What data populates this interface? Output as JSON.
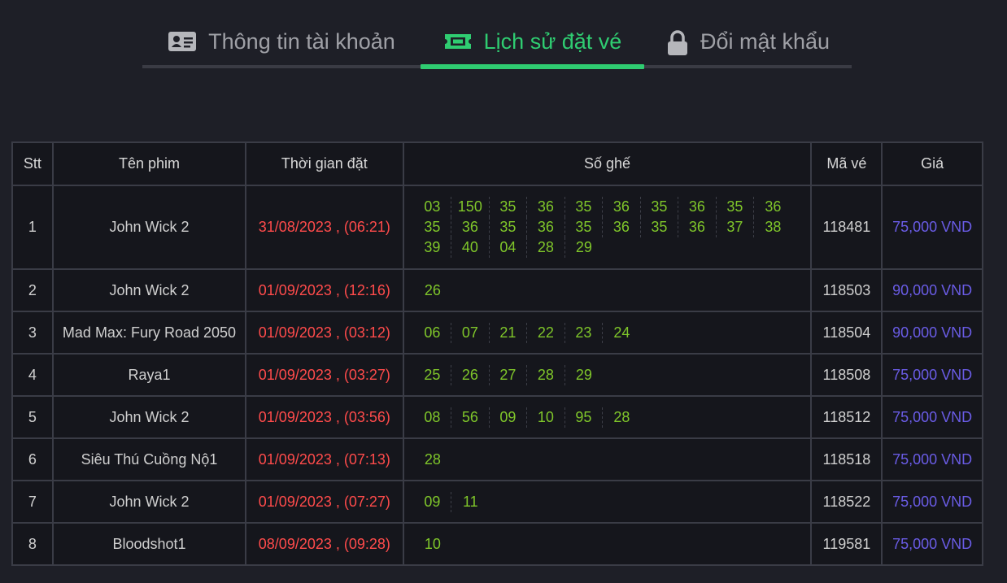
{
  "tabs": [
    {
      "label": "Thông tin tài khoản",
      "icon": "id-card-icon"
    },
    {
      "label": "Lịch sử đặt vé",
      "icon": "ticket-icon",
      "active": true
    },
    {
      "label": "Đổi mật khẩu",
      "icon": "lock-icon"
    }
  ],
  "colors": {
    "active_tab": "#2fcc71",
    "time": "#ff4b4b",
    "seat": "#7fc62a",
    "price": "#6a5ce6"
  },
  "table": {
    "headers": [
      "Stt",
      "Tên phim",
      "Thời gian đặt",
      "Số ghế",
      "Mã vé",
      "Giá"
    ],
    "rows": [
      {
        "stt": "1",
        "film": "John Wick 2",
        "time": "31/08/2023 , (06:21)",
        "seats": [
          "03",
          "150",
          "35",
          "36",
          "35",
          "36",
          "35",
          "36",
          "35",
          "36",
          "35",
          "36",
          "35",
          "36",
          "35",
          "36",
          "35",
          "36",
          "37",
          "38",
          "39",
          "40",
          "04",
          "28",
          "29"
        ],
        "code": "118481",
        "price": "75,000 VND"
      },
      {
        "stt": "2",
        "film": "John Wick 2",
        "time": "01/09/2023 , (12:16)",
        "seats": [
          "26"
        ],
        "code": "118503",
        "price": "90,000 VND"
      },
      {
        "stt": "3",
        "film": "Mad Max: Fury Road 2050",
        "time": "01/09/2023 , (03:12)",
        "seats": [
          "06",
          "07",
          "21",
          "22",
          "23",
          "24"
        ],
        "code": "118504",
        "price": "90,000 VND"
      },
      {
        "stt": "4",
        "film": "Raya1",
        "time": "01/09/2023 , (03:27)",
        "seats": [
          "25",
          "26",
          "27",
          "28",
          "29"
        ],
        "code": "118508",
        "price": "75,000 VND"
      },
      {
        "stt": "5",
        "film": "John Wick 2",
        "time": "01/09/2023 , (03:56)",
        "seats": [
          "08",
          "56",
          "09",
          "10",
          "95",
          "28"
        ],
        "code": "118512",
        "price": "75,000 VND"
      },
      {
        "stt": "6",
        "film": "Siêu Thú Cuồng Nộ1",
        "time": "01/09/2023 , (07:13)",
        "seats": [
          "28"
        ],
        "code": "118518",
        "price": "75,000 VND"
      },
      {
        "stt": "7",
        "film": "John Wick 2",
        "time": "01/09/2023 , (07:27)",
        "seats": [
          "09",
          "11"
        ],
        "code": "118522",
        "price": "75,000 VND"
      },
      {
        "stt": "8",
        "film": "Bloodshot1",
        "time": "08/09/2023 , (09:28)",
        "seats": [
          "10"
        ],
        "code": "119581",
        "price": "75,000 VND"
      }
    ]
  }
}
